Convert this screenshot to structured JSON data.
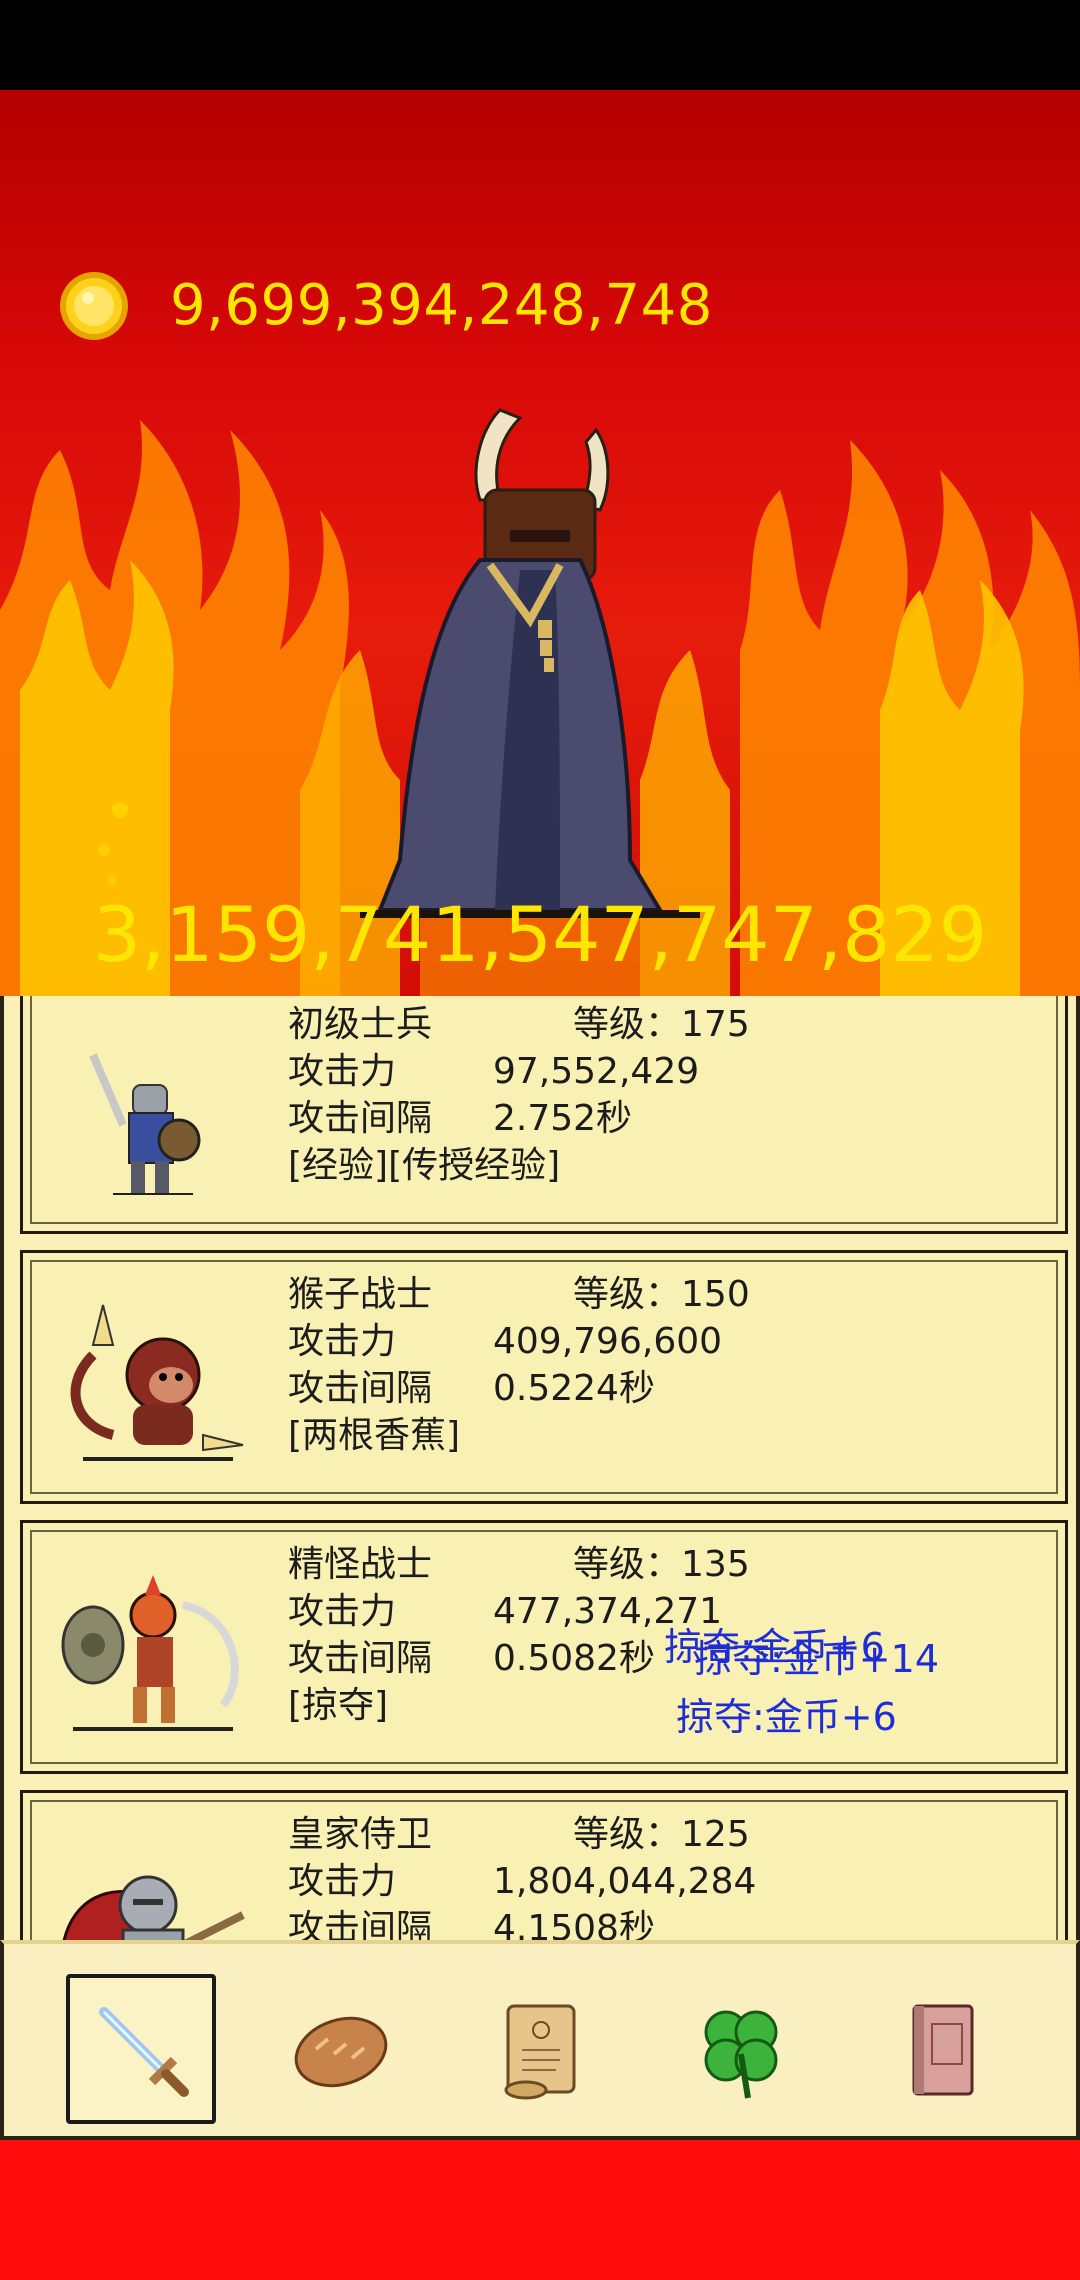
{
  "header": {
    "coins": "9,699,394,248,748",
    "boss_hp": "3,159,741,547,747,829"
  },
  "units": [
    {
      "name": "初级士兵",
      "level_label": "等级：",
      "level": "175",
      "atk_label": "攻击力",
      "atk": "97,552,429",
      "interval_label": "攻击间隔",
      "interval": "2.752秒",
      "skills": "[经验][传授经验]",
      "portrait_icon": "soldier-icon"
    },
    {
      "name": "猴子战士",
      "level_label": "等级：",
      "level": "150",
      "atk_label": "攻击力",
      "atk": "409,796,600",
      "interval_label": "攻击间隔",
      "interval": "0.5224秒",
      "skills": "[两根香蕉]",
      "portrait_icon": "monkey-icon"
    },
    {
      "name": "精怪战士",
      "level_label": "等级：",
      "level": "135",
      "atk_label": "攻击力",
      "atk": "477,374,271",
      "interval_label": "攻击间隔",
      "interval": "0.5082秒",
      "skills": "[掠夺]",
      "portrait_icon": "goblin-icon"
    },
    {
      "name": "皇家侍卫",
      "level_label": "等级：",
      "level": "125",
      "atk_label": "攻击力",
      "atk": "1,804,044,284",
      "interval_label": "攻击间隔",
      "interval": "4.1508秒",
      "portrait_icon": "royal-guard-icon"
    }
  ],
  "loot_popups": [
    "掠夺:金币+6",
    "掠夺:金币+14",
    "掠夺:金币+6"
  ],
  "tabs": [
    {
      "icon": "sword-icon",
      "active": true
    },
    {
      "icon": "bread-icon",
      "active": false
    },
    {
      "icon": "scroll-icon",
      "active": false
    },
    {
      "icon": "clover-icon",
      "active": false
    },
    {
      "icon": "book-icon",
      "active": false
    }
  ],
  "colors": {
    "gold_text": "#ffe600",
    "loot_text": "#1f2dd8",
    "panel_bg": "#f9efb7",
    "fire_red": "#e61c0c"
  }
}
